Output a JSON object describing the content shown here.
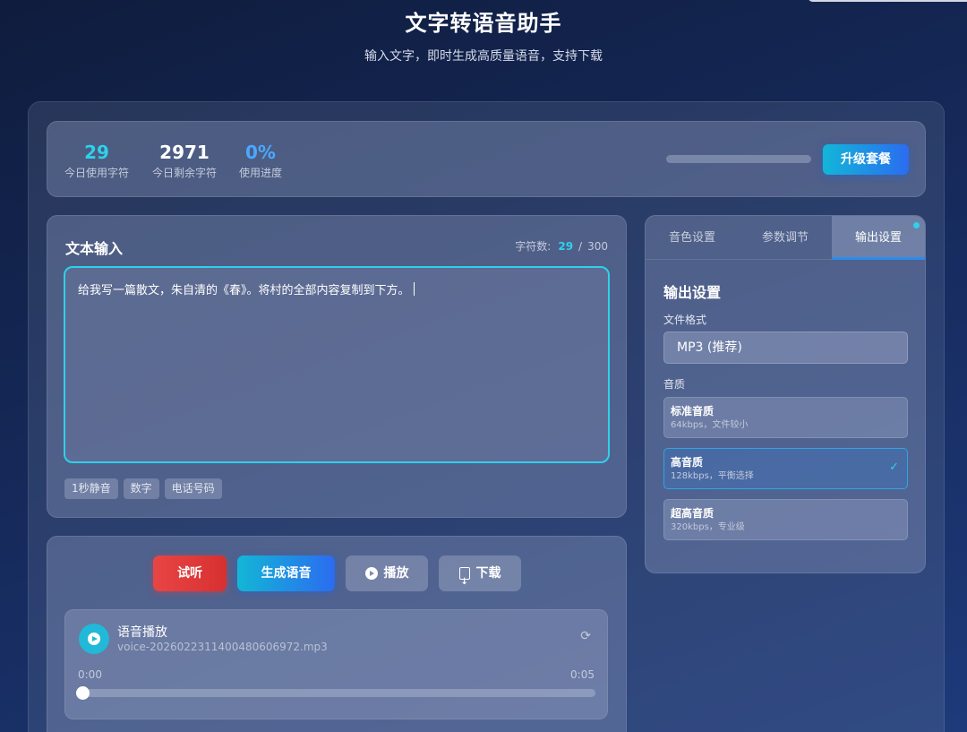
{
  "header": {
    "title": "文字转语音助手",
    "subtitle": "输入文字，即时生成高质量语音，支持下载"
  },
  "stats": {
    "used_today": {
      "value": "29",
      "label": "今日使用字符"
    },
    "remaining_today": {
      "value": "2971",
      "label": "今日剩余字符"
    },
    "progress": {
      "value": "0%",
      "label": "使用进度",
      "fraction": 0.0
    },
    "upgrade_label": "升级套餐"
  },
  "input": {
    "title": "文本输入",
    "count_label": "字符数:",
    "count_current": "29",
    "count_separator": "/",
    "count_max": "300",
    "text": "给我写一篇散文，朱自清的《春》。将村的全部内容复制到下方。",
    "tags": [
      "1秒静音",
      "数字",
      "电话号码"
    ]
  },
  "actions": {
    "try_label": "试听",
    "generate_label": "生成语音",
    "play_label": "播放",
    "download_label": "下载"
  },
  "player": {
    "title": "语音播放",
    "filename": "voice-20260223114004806069 72.mp3",
    "time_current": "0:00",
    "time_total": "0:05",
    "progress_fraction": 0.0
  },
  "settings": {
    "tabs": [
      "音色设置",
      "参数调节",
      "输出设置"
    ],
    "active_tab": 2,
    "section_title": "输出设置",
    "format_label": "文件格式",
    "format_value": "MP3 (推荐)",
    "quality_label": "音质",
    "quality_options": [
      {
        "name": "标准音质",
        "desc": "64kbps，文件较小"
      },
      {
        "name": "高音质",
        "desc": "128kbps，平衡选择"
      },
      {
        "name": "超高音质",
        "desc": "320kbps，专业级"
      }
    ],
    "selected_quality": 1
  },
  "colors": {
    "accent_cyan": "#2fd0ea",
    "accent_blue": "#2b6cf0",
    "danger_red": "#e84545"
  }
}
